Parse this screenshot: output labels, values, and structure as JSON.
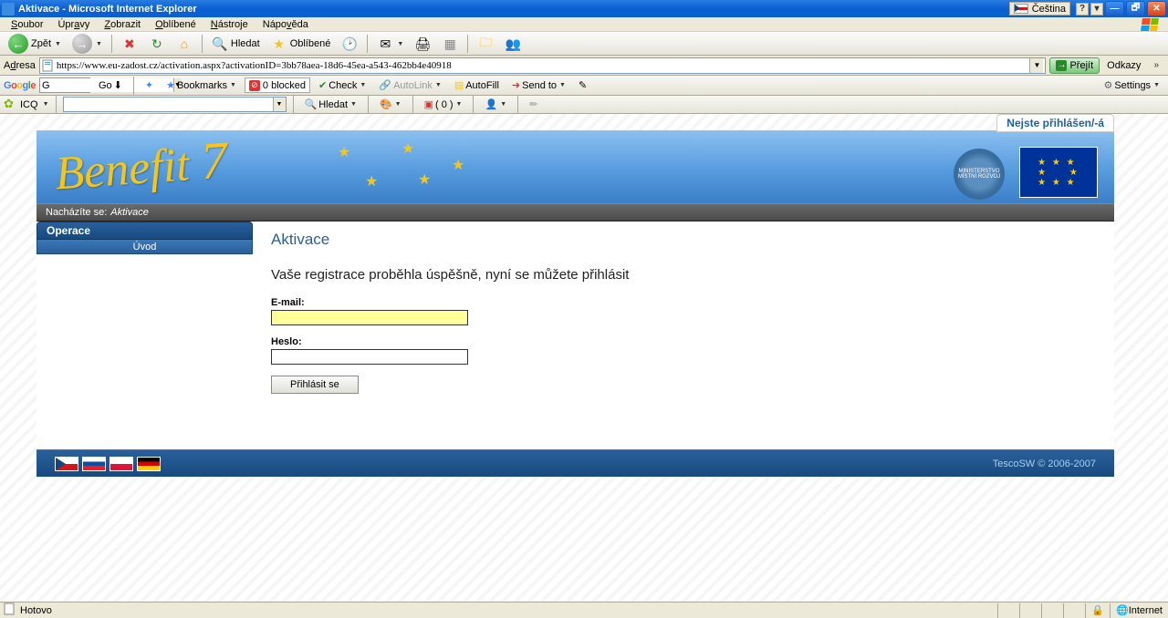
{
  "titlebar": {
    "title": "Aktivace - Microsoft Internet Explorer",
    "language": "Čeština"
  },
  "menubar": {
    "items": [
      "Soubor",
      "Úpravy",
      "Zobrazit",
      "Oblíbené",
      "Nástroje",
      "Nápověda"
    ]
  },
  "toolbar": {
    "back": "Zpět",
    "search": "Hledat",
    "favorites": "Oblíbené"
  },
  "addressbar": {
    "label": "Adresa",
    "url": "https://www.eu-zadost.cz/activation.aspx?activationID=3bb78aea-18d6-45ea-a543-462bb4e40918",
    "go": "Přejít",
    "links": "Odkazy"
  },
  "google_tb": {
    "go": "Go",
    "bookmarks": "Bookmarks",
    "blocked": "0 blocked",
    "check": "Check",
    "autolink": "AutoLink",
    "autofill": "AutoFill",
    "sendto": "Send to",
    "settings": "Settings"
  },
  "icq_tb": {
    "label": "ICQ",
    "search": "Hledat",
    "count": "( 0 )"
  },
  "page": {
    "auth_status": "Nejste přihlášen/-á",
    "logo": "Benefit",
    "crumb_label": "Nacházíte se:",
    "crumb_value": "Aktivace",
    "sidebar": {
      "header": "Operace",
      "item0": "Úvod"
    },
    "title": "Aktivace",
    "message": "Vaše registrace proběhla úspěšně, nyní se můžete přihlásit",
    "form": {
      "email_label": "E-mail:",
      "email_value": "",
      "password_label": "Heslo:",
      "password_value": "",
      "submit": "Přihlásit se"
    },
    "footer": {
      "copyright": "TescoSW © 2006-2007"
    }
  },
  "statusbar": {
    "status": "Hotovo",
    "zone": "Internet"
  }
}
